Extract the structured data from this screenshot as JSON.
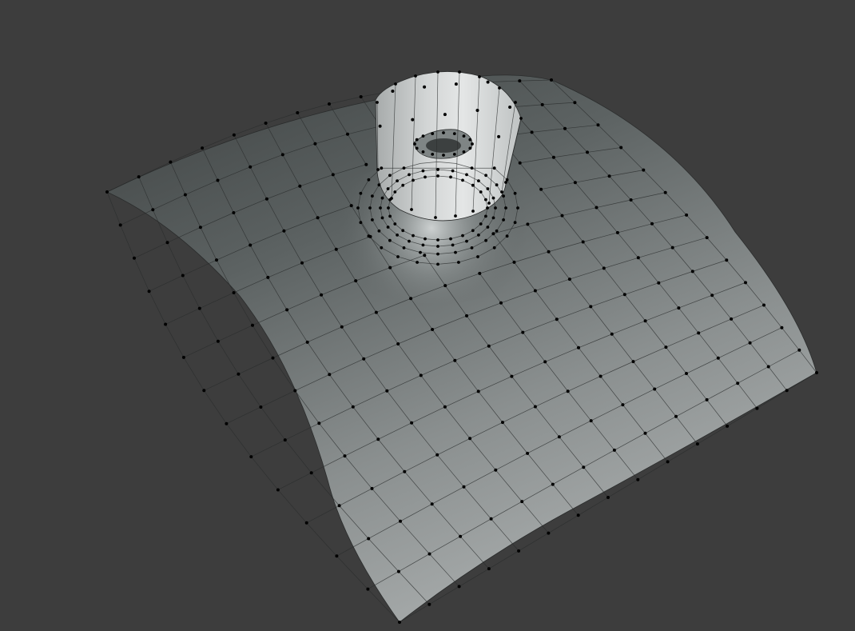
{
  "viewport": {
    "mode": "edit-mode",
    "background_color": "#3d3d3d"
  },
  "mesh": {
    "object": "curved-sheet-with-pipe-outlet",
    "surface_color_light": "#b8bcbc",
    "surface_color_dark": "#4a4e4e",
    "wire_color": "#2a2c2c",
    "vertex_color": "#000000",
    "selection": "none"
  }
}
